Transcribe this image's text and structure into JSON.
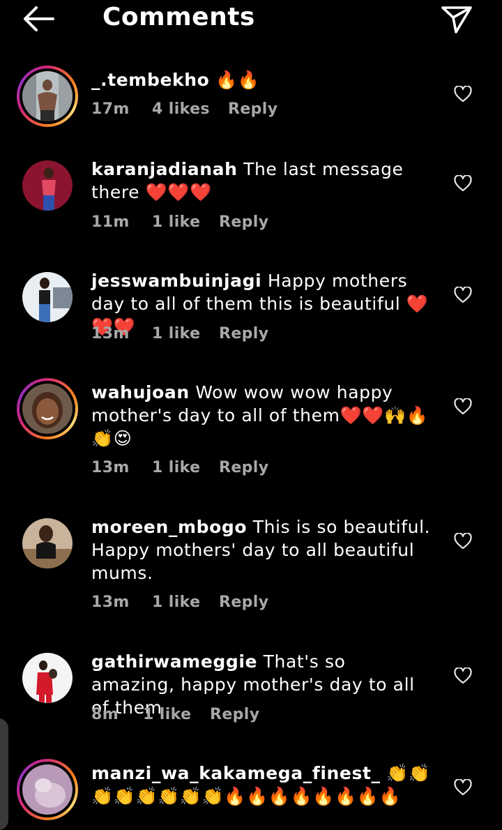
{
  "header": {
    "title": "Comments",
    "back_icon": "arrow-left-icon",
    "send_icon": "send-icon"
  },
  "colors": {
    "background": "#000000",
    "meta_text": "#a8a8a8",
    "story_ring": "#d62976"
  },
  "comments": [
    {
      "username": "_.tembekho",
      "text": "🔥🔥",
      "time": "17m",
      "likes": "4 likes",
      "reply": "Reply",
      "story": true
    },
    {
      "username": "karanjadianah",
      "text": "The last message there ❤️❤️❤️",
      "time": "11m",
      "likes": "1 like",
      "reply": "Reply",
      "story": false
    },
    {
      "username": "jesswambuinjagi",
      "text": "Happy mothers day to all of them this is beautiful ❤️❤️❤️",
      "time": "13m",
      "likes": "1 like",
      "reply": "Reply",
      "story": false
    },
    {
      "username": "wahujoan",
      "text": "Wow wow wow happy mother's day to all of them❤️❤️🙌🔥👏😍",
      "time": "13m",
      "likes": "1 like",
      "reply": "Reply",
      "story": true
    },
    {
      "username": "moreen_mbogo",
      "text": "This is so beautiful. Happy mothers' day to all beautiful mums.",
      "time": "13m",
      "likes": "1 like",
      "reply": "Reply",
      "story": false
    },
    {
      "username": "gathirwameggie",
      "text": "That's so amazing, happy mother's day to all of them",
      "time": "8m",
      "likes": "1 like",
      "reply": "Reply",
      "story": false
    },
    {
      "username": "manzi_wa_kakamega_finest_",
      "text": "👏👏👏👏👏👏👏👏🔥🔥🔥🔥🔥🔥🔥🔥",
      "story": true
    }
  ]
}
